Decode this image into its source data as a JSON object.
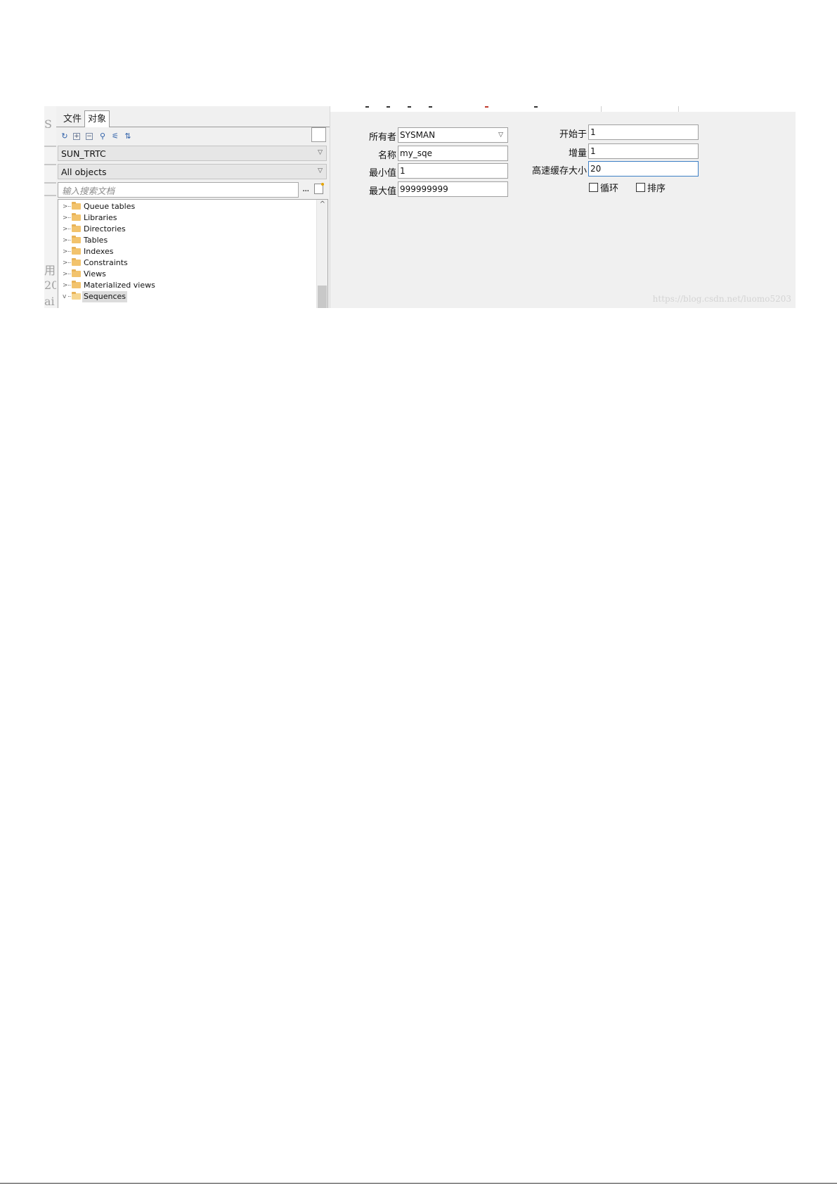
{
  "background_app": {
    "glyphs": [
      "S",
      "用",
      "20",
      "ai"
    ]
  },
  "object_browser": {
    "tabs": [
      {
        "label": "文件",
        "active": false
      },
      {
        "label": "对象",
        "active": true
      }
    ],
    "toolbar_icons": [
      "refresh-icon",
      "expand-all-icon",
      "collapse-all-icon",
      "find-icon",
      "filter-icon",
      "sort-icon"
    ],
    "owner_combo": {
      "value": "SUN_TRTC"
    },
    "filter_combo": {
      "value": "All objects"
    },
    "search": {
      "placeholder": "输入搜索文档",
      "more_label": "..."
    },
    "tree": [
      {
        "label": "Queue tables",
        "expanded": false
      },
      {
        "label": "Libraries",
        "expanded": false
      },
      {
        "label": "Directories",
        "expanded": false
      },
      {
        "label": "Tables",
        "expanded": false
      },
      {
        "label": "Indexes",
        "expanded": false
      },
      {
        "label": "Constraints",
        "expanded": false
      },
      {
        "label": "Views",
        "expanded": false
      },
      {
        "label": "Materialized views",
        "expanded": false
      },
      {
        "label": "Sequences",
        "expanded": true,
        "selected": true
      }
    ]
  },
  "sequence_form": {
    "owner": {
      "label": "所有者",
      "value": "SYSMAN"
    },
    "name": {
      "label": "名称",
      "value": "my_sqe"
    },
    "min_value": {
      "label": "最小值",
      "value": "1"
    },
    "max_value": {
      "label": "最大值",
      "value": "999999999"
    },
    "start_with": {
      "label": "开始于",
      "value": "1"
    },
    "increment": {
      "label": "增量",
      "value": "1"
    },
    "cache_size": {
      "label": "高速缓存大小",
      "value": "20"
    },
    "cycle": {
      "label": "循环",
      "checked": false
    },
    "order": {
      "label": "排序",
      "checked": false
    }
  },
  "watermark": "https://blog.csdn.net/luomo5203",
  "colors": {
    "panel_bg": "#f0f0f0",
    "focus_border": "#3c7fc5",
    "folder": "#f2c36d"
  }
}
